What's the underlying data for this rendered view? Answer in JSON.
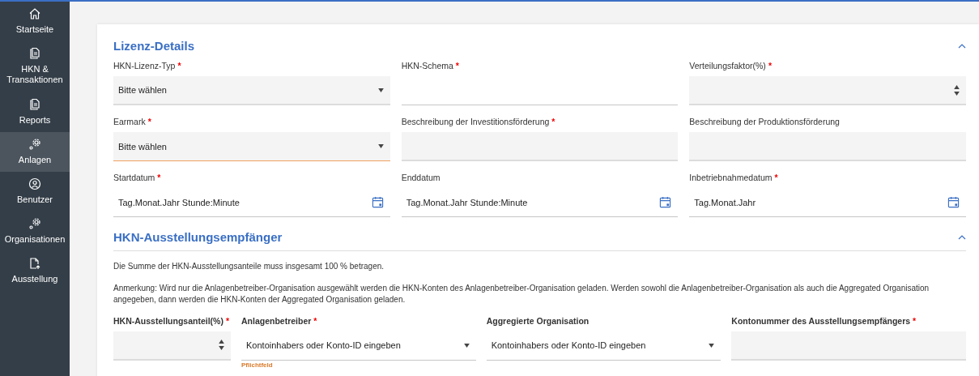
{
  "sidebar": {
    "items": [
      {
        "label": "Startseite",
        "kind": "home",
        "selected": false
      },
      {
        "label": "HKN &\nTransaktionen",
        "kind": "document",
        "selected": false
      },
      {
        "label": "Reports",
        "kind": "document",
        "selected": false
      },
      {
        "label": "Anlagen",
        "kind": "gears",
        "selected": true
      },
      {
        "label": "Benutzer",
        "kind": "user",
        "selected": false
      },
      {
        "label": "Organisationen",
        "kind": "gears",
        "selected": false
      },
      {
        "label": "Ausstellung",
        "kind": "export",
        "selected": false
      }
    ]
  },
  "license_details": {
    "title": "Lizenz-Details",
    "expanded": true,
    "fields": [
      {
        "label": "HKN-Lizenz-Typ",
        "required_mark": "*",
        "kind": "select",
        "filled": true,
        "placeholder": "Bitte wählen",
        "focused": false
      },
      {
        "label": "HKN-Schema",
        "required_mark": "*",
        "kind": "text",
        "filled": false,
        "focused": false
      },
      {
        "label": "Verteilungsfaktor(%)",
        "required_mark": "*",
        "kind": "number",
        "filled": true,
        "focused": false
      },
      {
        "label": "Earmark",
        "required_mark": "*",
        "kind": "select",
        "filled": true,
        "placeholder": "Bitte wählen",
        "focused": true
      },
      {
        "label": "Beschreibung der Investitionsförderung",
        "required_mark": "*",
        "kind": "text",
        "filled": true,
        "focused": false
      },
      {
        "label": "Beschreibung der Produktionsförderung",
        "kind": "text",
        "filled": true,
        "focused": false
      },
      {
        "label": "Startdatum",
        "required_mark": "*",
        "kind": "date",
        "filled": false,
        "placeholder": "Tag.Monat.Jahr Stunde:Minute",
        "focused": false
      },
      {
        "label": "Enddatum",
        "kind": "date",
        "filled": false,
        "placeholder": "Tag.Monat.Jahr Stunde:Minute",
        "focused": false
      },
      {
        "label": "Inbetriebnahmedatum",
        "required_mark": "*",
        "kind": "date",
        "filled": false,
        "placeholder": "Tag.Monat.Jahr",
        "focused": false
      }
    ]
  },
  "recipients": {
    "title": "HKN-Ausstellungsempfänger",
    "expanded": true,
    "notes": [
      "Die Summe der HKN-Ausstellungsanteile muss insgesamt 100 % betragen.",
      "Anmerkung: Wird nur die Anlagenbetreiber-Organisation ausgewählt werden die HKN-Konten des Anlagenbetreiber-Organisation geladen. Werden sowohl die Anlagenbetreiber-Organisation als auch die Aggregated Organisation angegeben, dann werden die HKN-Konten der Aggregated Organisation geladen."
    ],
    "fields": [
      {
        "label": "HKN-Ausstellungsanteil(%)",
        "required_mark": "*",
        "kind": "number",
        "filled": true,
        "focused": false
      },
      {
        "label": "Anlagenbetreiber",
        "required_mark": "*",
        "kind": "select",
        "filled": false,
        "placeholder": "Kontoinhabers oder Konto-ID eingeben",
        "focused": false,
        "error": "Pflichtfeld"
      },
      {
        "label": "Aggregierte Organisation",
        "kind": "select",
        "filled": false,
        "placeholder": "Kontoinhabers oder Konto-ID eingeben",
        "focused": false
      },
      {
        "label": "Kontonummer des Ausstellungsempfängers",
        "required_mark": "*",
        "kind": "text",
        "filled": true,
        "focused": false
      }
    ]
  }
}
